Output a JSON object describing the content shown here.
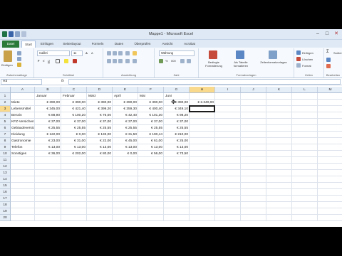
{
  "app": {
    "title": "Mappe1 - Microsoft Excel",
    "tabs": [
      "Datei",
      "Start",
      "Einfügen",
      "Seitenlayout",
      "Formeln",
      "Daten",
      "Überprüfen",
      "Ansicht",
      "Acrobat"
    ],
    "active_tab": "Start"
  },
  "ribbon": {
    "clipboard": {
      "paste": "Einfügen",
      "label": "Zwischenablage"
    },
    "font": {
      "name": "Calibri",
      "size": "11",
      "label": "Schriftart"
    },
    "alignment": {
      "label": "Ausrichtung"
    },
    "number": {
      "format": "Währung",
      "label": "Zahl"
    },
    "styles": {
      "conditional": "Bedingte Formatierung",
      "table": "Als Tabelle formatieren",
      "cellstyles": "Zellenformatvorlagen",
      "label": "Formatvorlagen"
    },
    "cells": {
      "insert": "Einfügen",
      "delete": "Löschen",
      "format": "Format",
      "label": "Zellen"
    },
    "editing": {
      "sort": "Sortieren und Filtern",
      "label": "Bearbeiten"
    }
  },
  "formula_bar": {
    "namebox": "H3",
    "fx": "fx",
    "content": ""
  },
  "sheet": {
    "columns": [
      "A",
      "B",
      "C",
      "D",
      "E",
      "F",
      "G",
      "H",
      "I",
      "J",
      "K",
      "L",
      "M"
    ],
    "selected_col": "H",
    "selected_row": "3",
    "rows": [
      [
        "",
        "Januar",
        "Februar",
        "März",
        "April",
        "Mai",
        "Juni",
        ""
      ],
      [
        "Miete",
        "€ 390,00",
        "€ 390,00",
        "€ 390,00",
        "€ 390,00",
        "€ 390,00",
        "€ 390,00",
        "€ 2.340,00"
      ],
      [
        "Lebensmittel",
        "€ 345,00",
        "€ 421,40",
        "€ 399,20",
        "€ 359,30",
        "€ 400,40",
        "€ 349,10",
        ""
      ],
      [
        "Benzin",
        "€ 88,90",
        "€ 100,20",
        "€ 76,00",
        "€ 42,40",
        "€ 101,30",
        "€ 98,20",
        ""
      ],
      [
        "KFZ-Versicherung",
        "€ 37,00",
        "€ 37,00",
        "€ 37,00",
        "€ 37,00",
        "€ 37,00",
        "€ 37,00",
        ""
      ],
      [
        "Gebäudeversicherung",
        "€ 25,55",
        "€ 25,55",
        "€ 25,55",
        "€ 25,55",
        "€ 25,55",
        "€ 25,55",
        ""
      ],
      [
        "Kleidung",
        "€ 122,00",
        "€ 0,00",
        "€ 133,00",
        "€ 31,50",
        "€ 190,44",
        "€ 210,00",
        ""
      ],
      [
        "Gastronomie",
        "€ 23,00",
        "€ 31,00",
        "€ 22,00",
        "€ 45,00",
        "€ 61,00",
        "€ 25,00",
        ""
      ],
      [
        "Telefon",
        "€ 13,00",
        "€ 13,00",
        "€ 13,00",
        "€ 13,00",
        "€ 13,00",
        "€ 13,00",
        ""
      ],
      [
        "Sonstiges",
        "€ 36,00",
        "€ 202,00",
        "€ 80,00",
        "€ 0,00",
        "€ 56,00",
        "€ 73,50",
        ""
      ]
    ],
    "empty_rows": [
      "11",
      "12",
      "13",
      "14",
      "15",
      "16",
      "17",
      "18",
      "19",
      "20"
    ]
  }
}
